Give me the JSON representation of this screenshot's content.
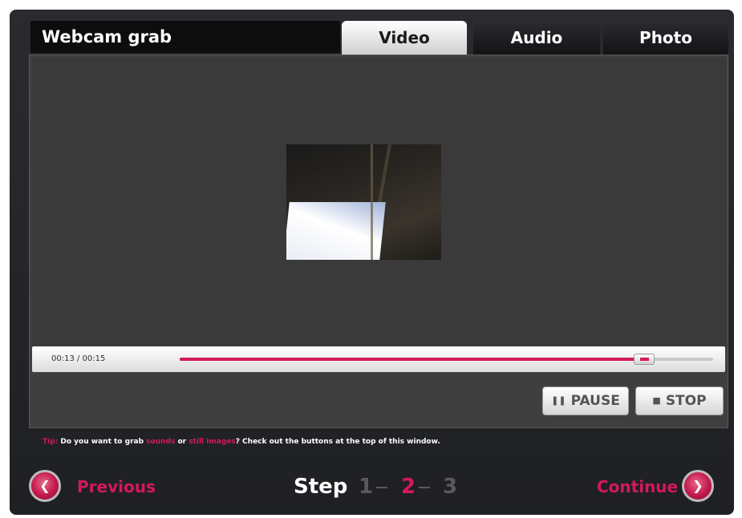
{
  "app": {
    "title": "Webcam grab"
  },
  "tabs": [
    {
      "label": "Video",
      "active": true
    },
    {
      "label": "Audio",
      "active": false
    },
    {
      "label": "Photo",
      "active": false
    }
  ],
  "player": {
    "timecode": "00:13 / 00:15",
    "progress": 0.87,
    "pause_label": "PAUSE",
    "pause_icon": "pause-icon",
    "stop_label": "STOP",
    "stop_icon": "stop-icon"
  },
  "tip": {
    "prefix": "Tip:",
    "text1": " Do you want to grab ",
    "link1": "sounds",
    "text2": " or ",
    "link2": "still images",
    "text3": "? Check out the buttons at the top of this window."
  },
  "nav": {
    "previous_label": "Previous",
    "continue_label": "Continue",
    "step_label": "Step",
    "steps": [
      "1",
      "2",
      "3"
    ],
    "current_step": "2"
  },
  "colors": {
    "accent": "#d4195a",
    "step_inactive": "#5a5a5a",
    "step_active": "#d4195a"
  }
}
